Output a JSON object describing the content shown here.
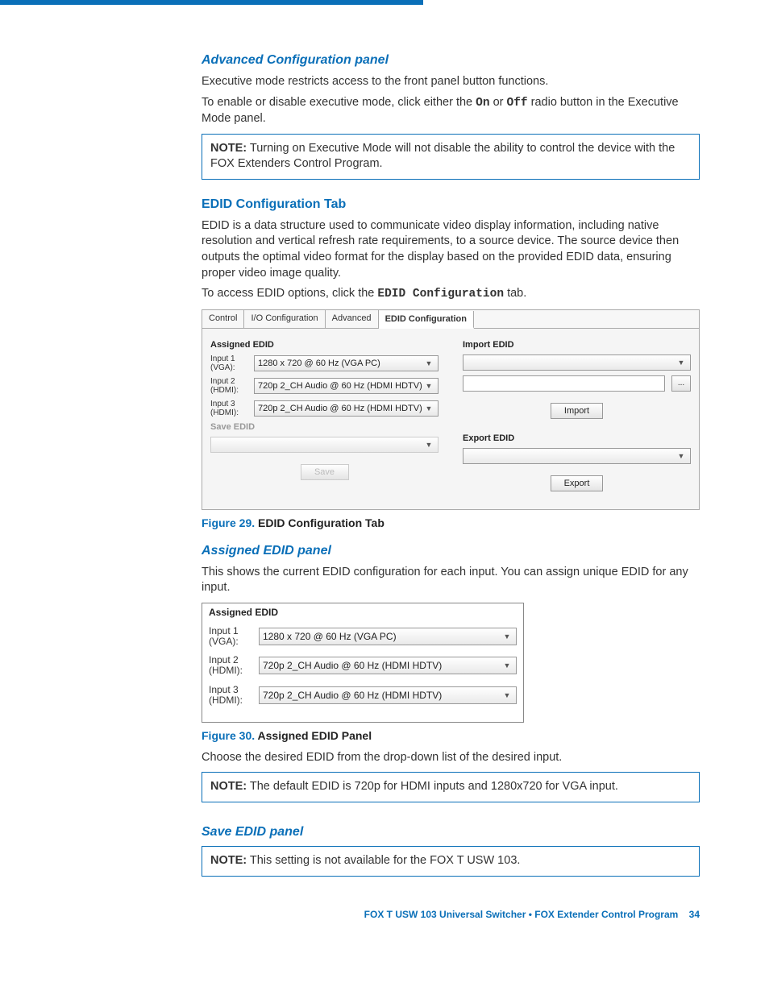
{
  "headings": {
    "advanced": "Advanced Configuration panel",
    "edid_tab": "EDID Configuration Tab",
    "assigned_panel": "Assigned EDID panel",
    "save_panel": "Save EDID panel"
  },
  "paragraphs": {
    "adv_p1": "Executive mode restricts access to the front panel button functions.",
    "adv_p2_a": "To enable or disable executive mode,  click either the ",
    "adv_p2_on": "On",
    "adv_p2_mid": " or ",
    "adv_p2_off": "Off",
    "adv_p2_b": " radio button in the Executive Mode panel.",
    "edid_p1": "EDID is a data structure used to communicate video display information, including native resolution and vertical refresh rate requirements, to a source device. The source device then outputs the optimal video format for the display based on the provided EDID data, ensuring proper video image quality.",
    "edid_p2_a": "To access EDID options, click the ",
    "edid_p2_tab": "EDID Configuration",
    "edid_p2_b": " tab.",
    "assigned_p1": "This shows the current EDID configuration for each input. You can assign unique EDID for any input.",
    "assigned_p2": "Choose the desired EDID from the drop-down list of the desired input."
  },
  "notes": {
    "label": "NOTE:",
    "note1": "  Turning on Executive Mode will not disable the ability to control the device with the FOX Extenders Control Program.",
    "note2": "  The default EDID is 720p for HDMI inputs and 1280x720 for VGA input.",
    "note3": "  This setting is not available for the FOX T USW 103."
  },
  "figure29": {
    "num": "Figure 29.",
    "title": "  EDID Configuration Tab",
    "tabs": [
      "Control",
      "I/O Configuration",
      "Advanced",
      "EDID Configuration"
    ],
    "assigned": {
      "title": "Assigned EDID",
      "rows": [
        {
          "label": "Input 1 (VGA):",
          "value": "1280 x 720 @ 60 Hz (VGA PC)"
        },
        {
          "label": "Input 2 (HDMI):",
          "value": "720p 2_CH Audio @ 60 Hz (HDMI HDTV)"
        },
        {
          "label": "Input 3 (HDMI):",
          "value": "720p 2_CH Audio @ 60 Hz (HDMI HDTV)"
        }
      ]
    },
    "save_group": {
      "title": "Save EDID",
      "button": "Save"
    },
    "import_group": {
      "title": "Import EDID",
      "button": "Import",
      "browse": "..."
    },
    "export_group": {
      "title": "Export EDID",
      "button": "Export"
    }
  },
  "figure30": {
    "num": "Figure 30.",
    "title": "  Assigned EDID Panel",
    "panel_title": "Assigned EDID",
    "rows": [
      {
        "label": "Input 1 (VGA):",
        "value": "1280 x 720 @ 60 Hz (VGA PC)"
      },
      {
        "label": "Input 2 (HDMI):",
        "value": "720p 2_CH Audio @ 60 Hz (HDMI HDTV)"
      },
      {
        "label": "Input 3 (HDMI):",
        "value": "720p 2_CH Audio @ 60 Hz (HDMI HDTV)"
      }
    ]
  },
  "footer": {
    "product": "FOX T USW 103 Universal Switcher • FOX Extender Control Program",
    "page": "34"
  }
}
